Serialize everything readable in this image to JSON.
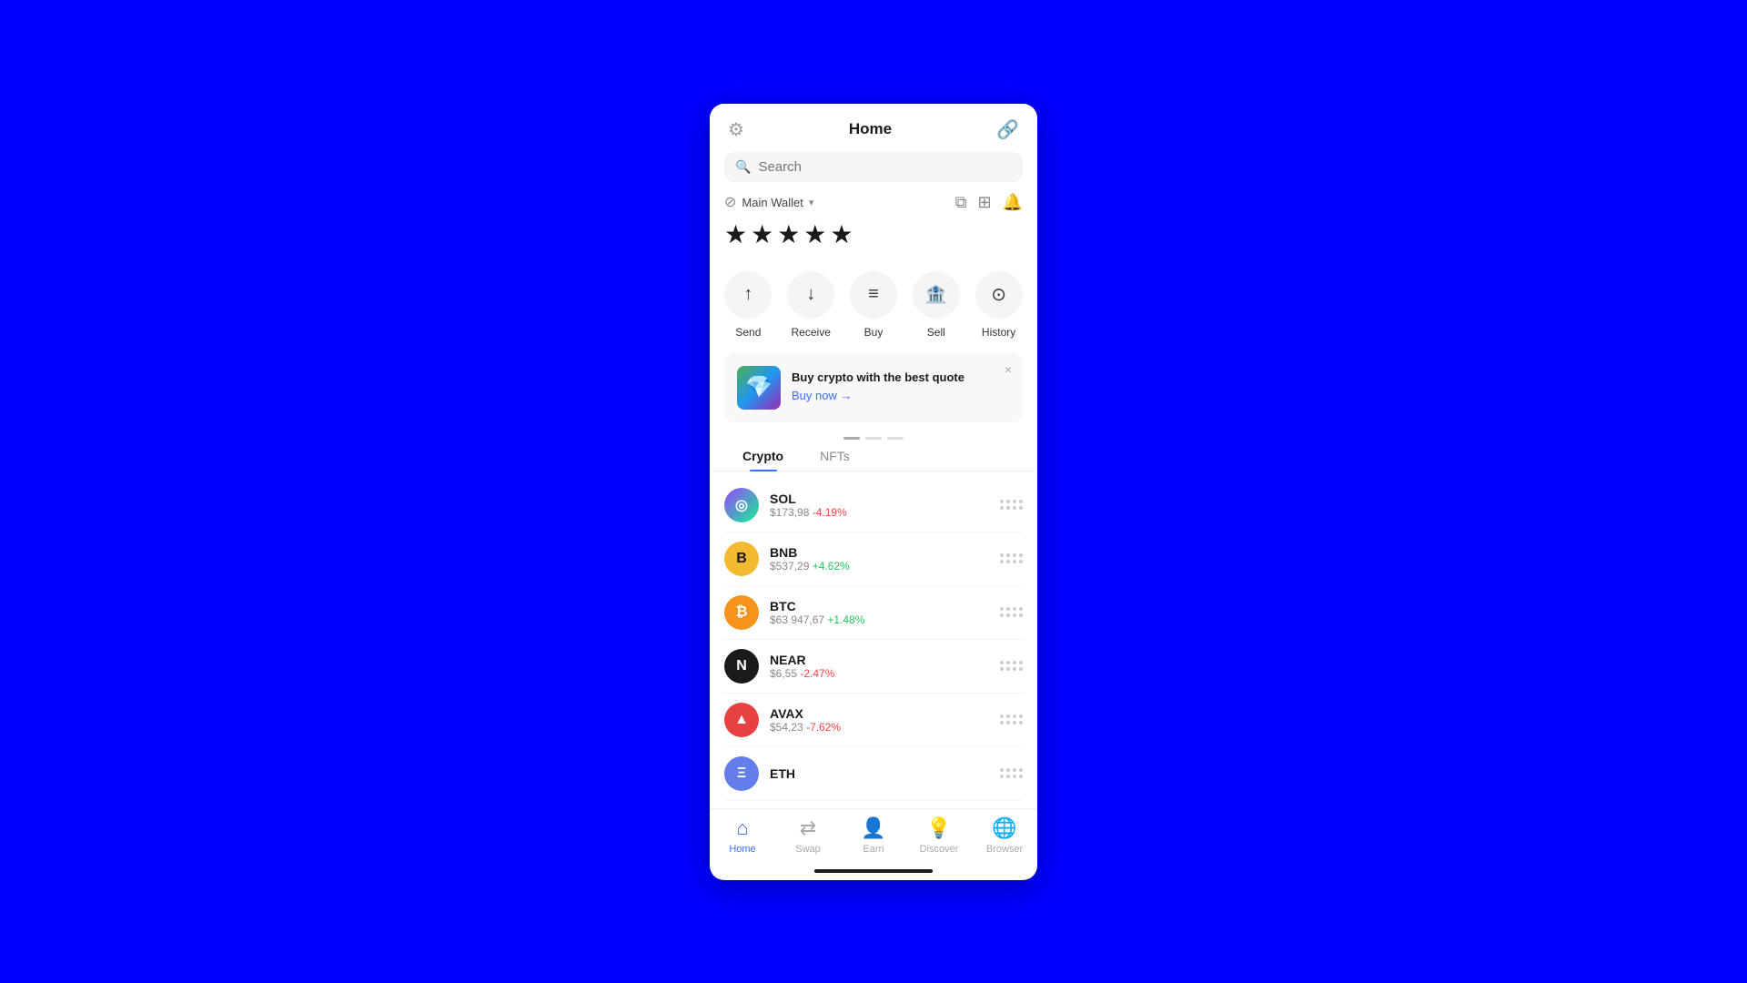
{
  "header": {
    "title": "Home",
    "settings_icon": "⚙",
    "link_icon": "🔗"
  },
  "search": {
    "placeholder": "Search"
  },
  "wallet": {
    "name": "Main Wallet",
    "balance_hidden": "★★★★★",
    "icons": {
      "copy": "⧉",
      "scan": "⊞",
      "bell": "🔔"
    }
  },
  "actions": [
    {
      "id": "send",
      "label": "Send",
      "icon": "↑"
    },
    {
      "id": "receive",
      "label": "Receive",
      "icon": "↓"
    },
    {
      "id": "buy",
      "label": "Buy",
      "icon": "≡"
    },
    {
      "id": "sell",
      "label": "Sell",
      "icon": "🏦"
    },
    {
      "id": "history",
      "label": "History",
      "icon": "⊙"
    }
  ],
  "banner": {
    "title": "Buy crypto with the best quote",
    "link": "Buy now →",
    "close": "×"
  },
  "tabs": [
    {
      "id": "crypto",
      "label": "Crypto",
      "active": true
    },
    {
      "id": "nfts",
      "label": "NFTs",
      "active": false
    }
  ],
  "cryptos": [
    {
      "symbol": "SOL",
      "price": "$173,98",
      "change": "-4.19%",
      "change_type": "neg",
      "icon_class": "icon-sol",
      "icon_text": "◎"
    },
    {
      "symbol": "BNB",
      "price": "$537,29",
      "change": "+4.62%",
      "change_type": "pos",
      "icon_class": "icon-bnb",
      "icon_text": "B"
    },
    {
      "symbol": "BTC",
      "price": "$63 947,67",
      "change": "+1.48%",
      "change_type": "pos",
      "icon_class": "icon-btc",
      "icon_text": "₿"
    },
    {
      "symbol": "NEAR",
      "price": "$6,55",
      "change": "-2.47%",
      "change_type": "neg",
      "icon_class": "icon-near",
      "icon_text": "N"
    },
    {
      "symbol": "AVAX",
      "price": "$54,23",
      "change": "-7.62%",
      "change_type": "neg",
      "icon_class": "icon-avax",
      "icon_text": "▲"
    },
    {
      "symbol": "ETH",
      "price": "",
      "change": "",
      "change_type": "pos",
      "icon_class": "icon-eth",
      "icon_text": "Ξ"
    }
  ],
  "bottom_nav": [
    {
      "id": "home",
      "label": "Home",
      "icon": "⌂",
      "active": true
    },
    {
      "id": "swap",
      "label": "Swap",
      "icon": "⇄",
      "active": false
    },
    {
      "id": "earn",
      "label": "Earn",
      "icon": "👤",
      "active": false
    },
    {
      "id": "discover",
      "label": "Discover",
      "icon": "💡",
      "active": false
    },
    {
      "id": "browser",
      "label": "Browser",
      "icon": "🌐",
      "active": false
    }
  ]
}
